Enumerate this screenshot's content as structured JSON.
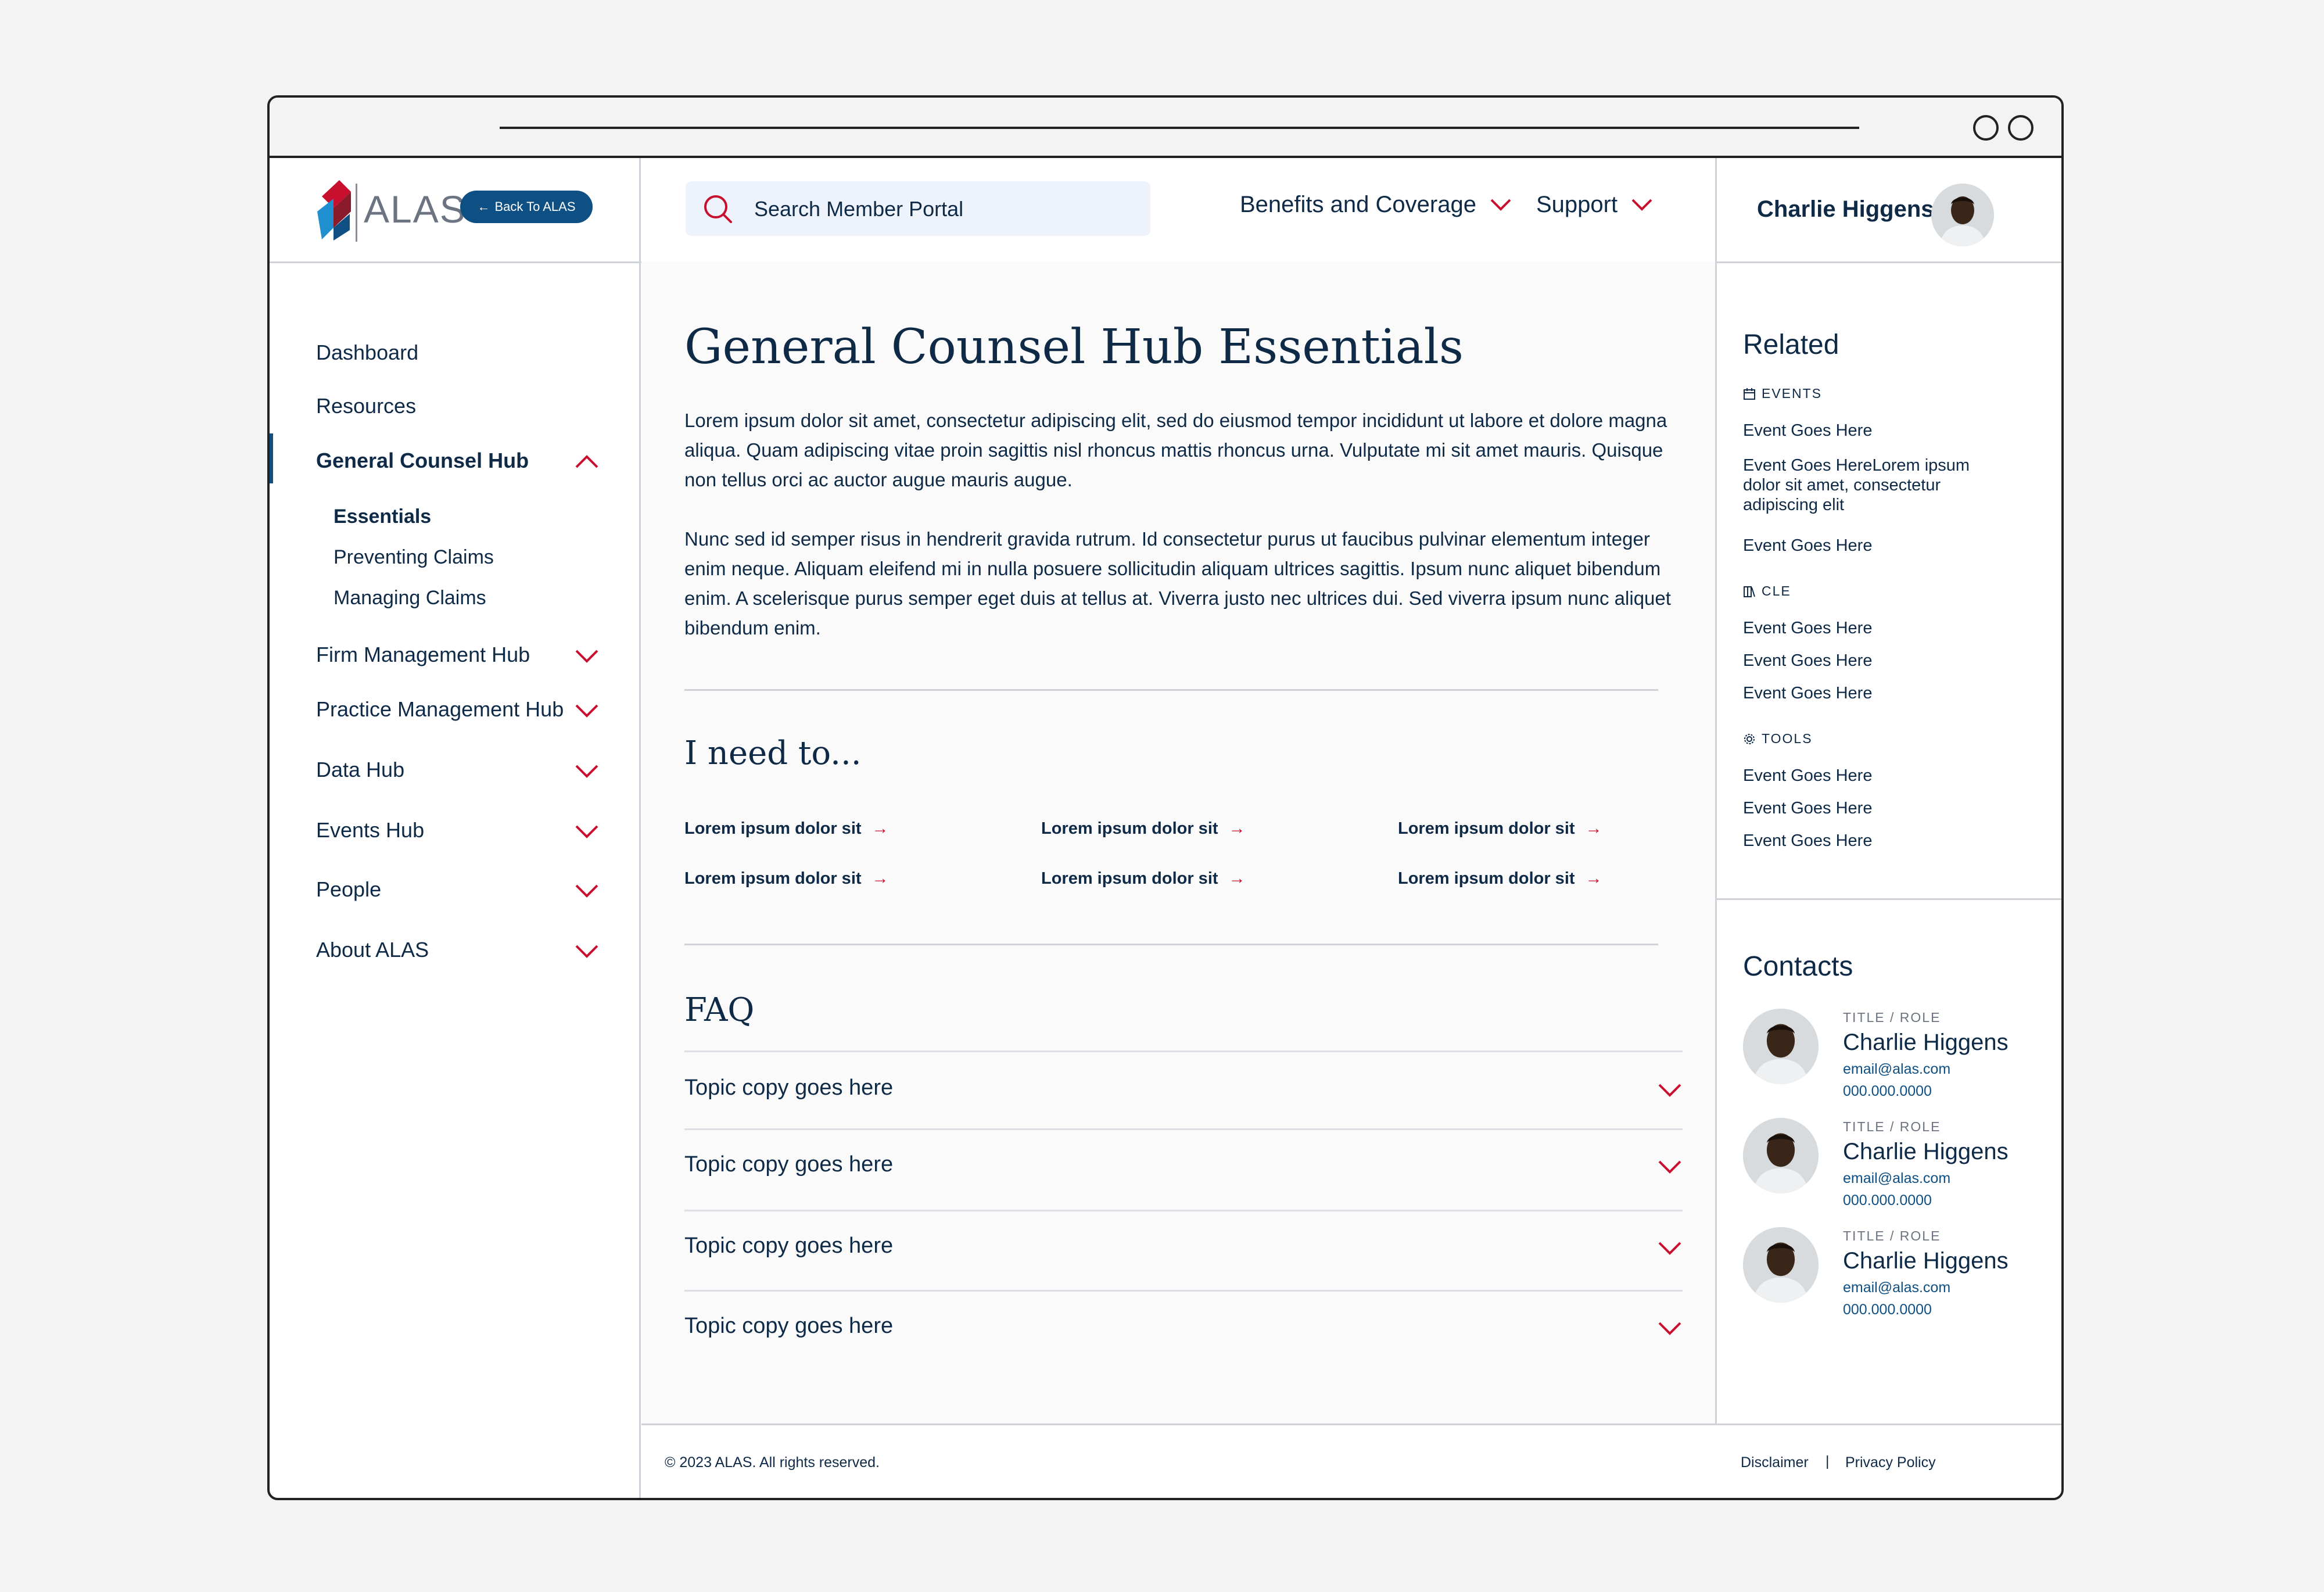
{
  "brand": {
    "logo_text": "ALAS",
    "back_label": "Back To ALAS"
  },
  "search": {
    "placeholder": "Search Member Portal"
  },
  "top_nav": [
    {
      "label": "Benefits and Coverage"
    },
    {
      "label": "Support"
    }
  ],
  "user": {
    "name": "Charlie Higgens"
  },
  "sidebar": {
    "items": [
      {
        "label": "Dashboard"
      },
      {
        "label": "Resources"
      },
      {
        "label": "General Counsel Hub"
      },
      {
        "label": "Firm Management Hub"
      },
      {
        "label": "Practice Management Hub"
      },
      {
        "label": "Data Hub"
      },
      {
        "label": "Events Hub"
      },
      {
        "label": "People"
      },
      {
        "label": "About ALAS"
      }
    ],
    "sub_items": [
      {
        "label": "Essentials"
      },
      {
        "label": "Preventing Claims"
      },
      {
        "label": "Managing Claims"
      }
    ]
  },
  "main": {
    "title": "General Counsel Hub Essentials",
    "paragraphs": [
      "Lorem ipsum dolor sit amet, consectetur adipiscing elit, sed do eiusmod tempor incididunt ut labore et dolore magna aliqua. Quam adipiscing vitae proin sagittis nisl rhoncus mattis rhoncus urna. Vulputate mi sit amet mauris. Quisque non tellus orci ac auctor augue mauris augue.",
      "Nunc sed id semper risus in hendrerit gravida rutrum. Id consectetur purus ut faucibus pulvinar elementum integer enim neque. Aliquam eleifend mi in nulla posuere sollicitudin aliquam ultrices sagittis. Ipsum nunc aliquet bibendum enim. A scelerisque purus semper eget duis at tellus at. Viverra justo nec ultrices dui. Sed viverra ipsum nunc aliquet bibendum enim."
    ],
    "need_title": "I need to...",
    "need_links": [
      "Lorem ipsum dolor sit",
      "Lorem ipsum dolor sit",
      "Lorem ipsum dolor sit",
      "Lorem ipsum dolor sit",
      "Lorem ipsum dolor sit",
      "Lorem ipsum dolor sit"
    ],
    "faq_title": "FAQ",
    "faq_items": [
      "Topic copy goes here",
      "Topic copy goes here",
      "Topic copy goes here",
      "Topic copy goes here"
    ]
  },
  "related": {
    "title": "Related",
    "events_label": "EVENTS",
    "events": [
      "Event Goes Here",
      "Event Goes HereLorem ipsum dolor sit amet, consectetur adipiscing elit",
      "Event Goes Here"
    ],
    "cle_label": "CLE",
    "cle": [
      "Event Goes Here",
      "Event Goes Here",
      "Event Goes Here"
    ],
    "tools_label": "TOOLS",
    "tools": [
      "Event Goes Here",
      "Event Goes Here",
      "Event Goes Here"
    ]
  },
  "contacts": {
    "title": "Contacts",
    "people": [
      {
        "role": "TITLE / ROLE",
        "name": "Charlie Higgens",
        "email": "email@alas.com",
        "phone": "000.000.0000"
      },
      {
        "role": "TITLE / ROLE",
        "name": "Charlie Higgens",
        "email": "email@alas.com",
        "phone": "000.000.0000"
      },
      {
        "role": "TITLE / ROLE",
        "name": "Charlie Higgens",
        "email": "email@alas.com",
        "phone": "000.000.0000"
      }
    ]
  },
  "footer": {
    "copyright": "© 2023 ALAS. All rights reserved.",
    "disclaimer": "Disclaimer",
    "separator": "|",
    "privacy": "Privacy Policy"
  },
  "colors": {
    "navy": "#0e2a47",
    "brand_blue": "#0e4f84",
    "accent_red": "#c8102e"
  },
  "icons": {
    "search": "search-icon",
    "chevron": "chevron-down-icon",
    "arrow": "arrow-right-icon",
    "events": "calendar-icon",
    "cle": "book-icon",
    "tools": "gear-icon"
  }
}
